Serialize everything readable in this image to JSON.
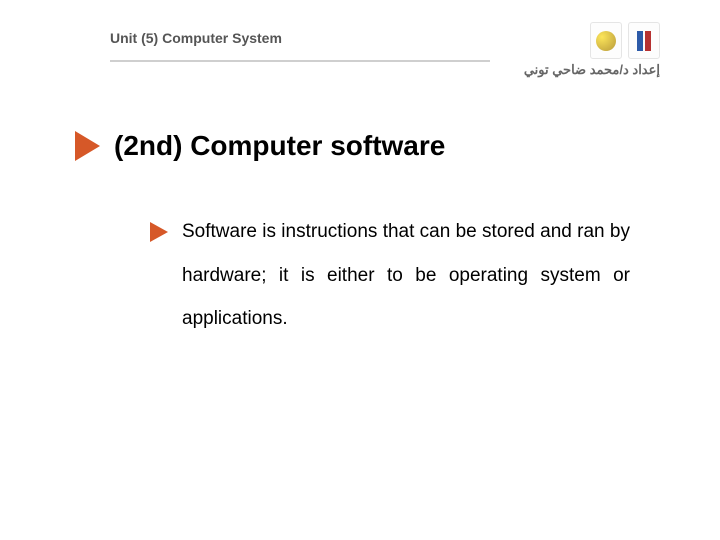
{
  "header": {
    "unit_label": "Unit (5) Computer System",
    "author": "إعداد د/محمد ضاحي توني"
  },
  "logos": {
    "left_icon": "emblem-circle-icon",
    "right_icon": "org-bars-icon"
  },
  "title": "(2nd) Computer software",
  "body": "Software is instructions that can be stored and ran by hardware; it is either to be operating system or applications."
}
